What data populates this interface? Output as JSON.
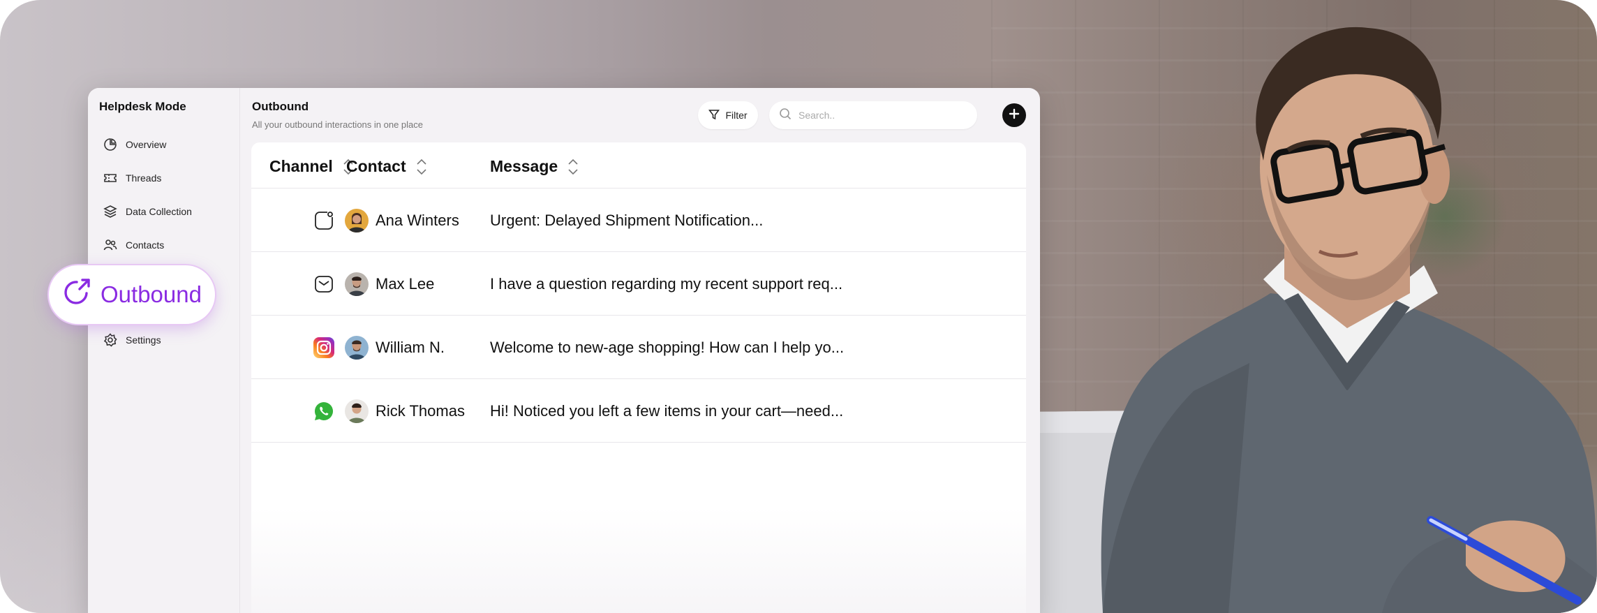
{
  "sidebar": {
    "brand": "Helpdesk Mode",
    "items": [
      {
        "label": "Overview",
        "icon": "pie-chart-icon"
      },
      {
        "label": "Threads",
        "icon": "ticket-icon"
      },
      {
        "label": "Data Collection",
        "icon": "layers-icon"
      },
      {
        "label": "Contacts",
        "icon": "users-icon"
      },
      {
        "label": "Settings",
        "icon": "gear-icon"
      }
    ]
  },
  "callout": {
    "label": "Outbound",
    "icon": "outbound-arrow-icon",
    "color": "#8a2be2"
  },
  "header": {
    "title": "Outbound",
    "subtitle": "All your outbound interactions in one place",
    "filter_label": "Filter",
    "search_placeholder": "Search.."
  },
  "table": {
    "columns": [
      "Channel",
      "Contact",
      "Message"
    ],
    "rows": [
      {
        "channel": "chat-bubble-icon",
        "contact": "Ana Winters",
        "message": "Urgent: Delayed Shipment Notification..."
      },
      {
        "channel": "email-icon",
        "contact": "Max Lee",
        "message": "I have a question regarding my recent support req..."
      },
      {
        "channel": "instagram-icon",
        "contact": "William N.",
        "message": "Welcome to new-age shopping! How can I help yo..."
      },
      {
        "channel": "whatsapp-icon",
        "contact": "Rick Thomas",
        "message": "Hi! Noticed you left a few items in your cart—need..."
      }
    ]
  },
  "colors": {
    "accent": "#8a2be2",
    "whatsapp": "#34b33b",
    "instagram": "#e1306c"
  }
}
